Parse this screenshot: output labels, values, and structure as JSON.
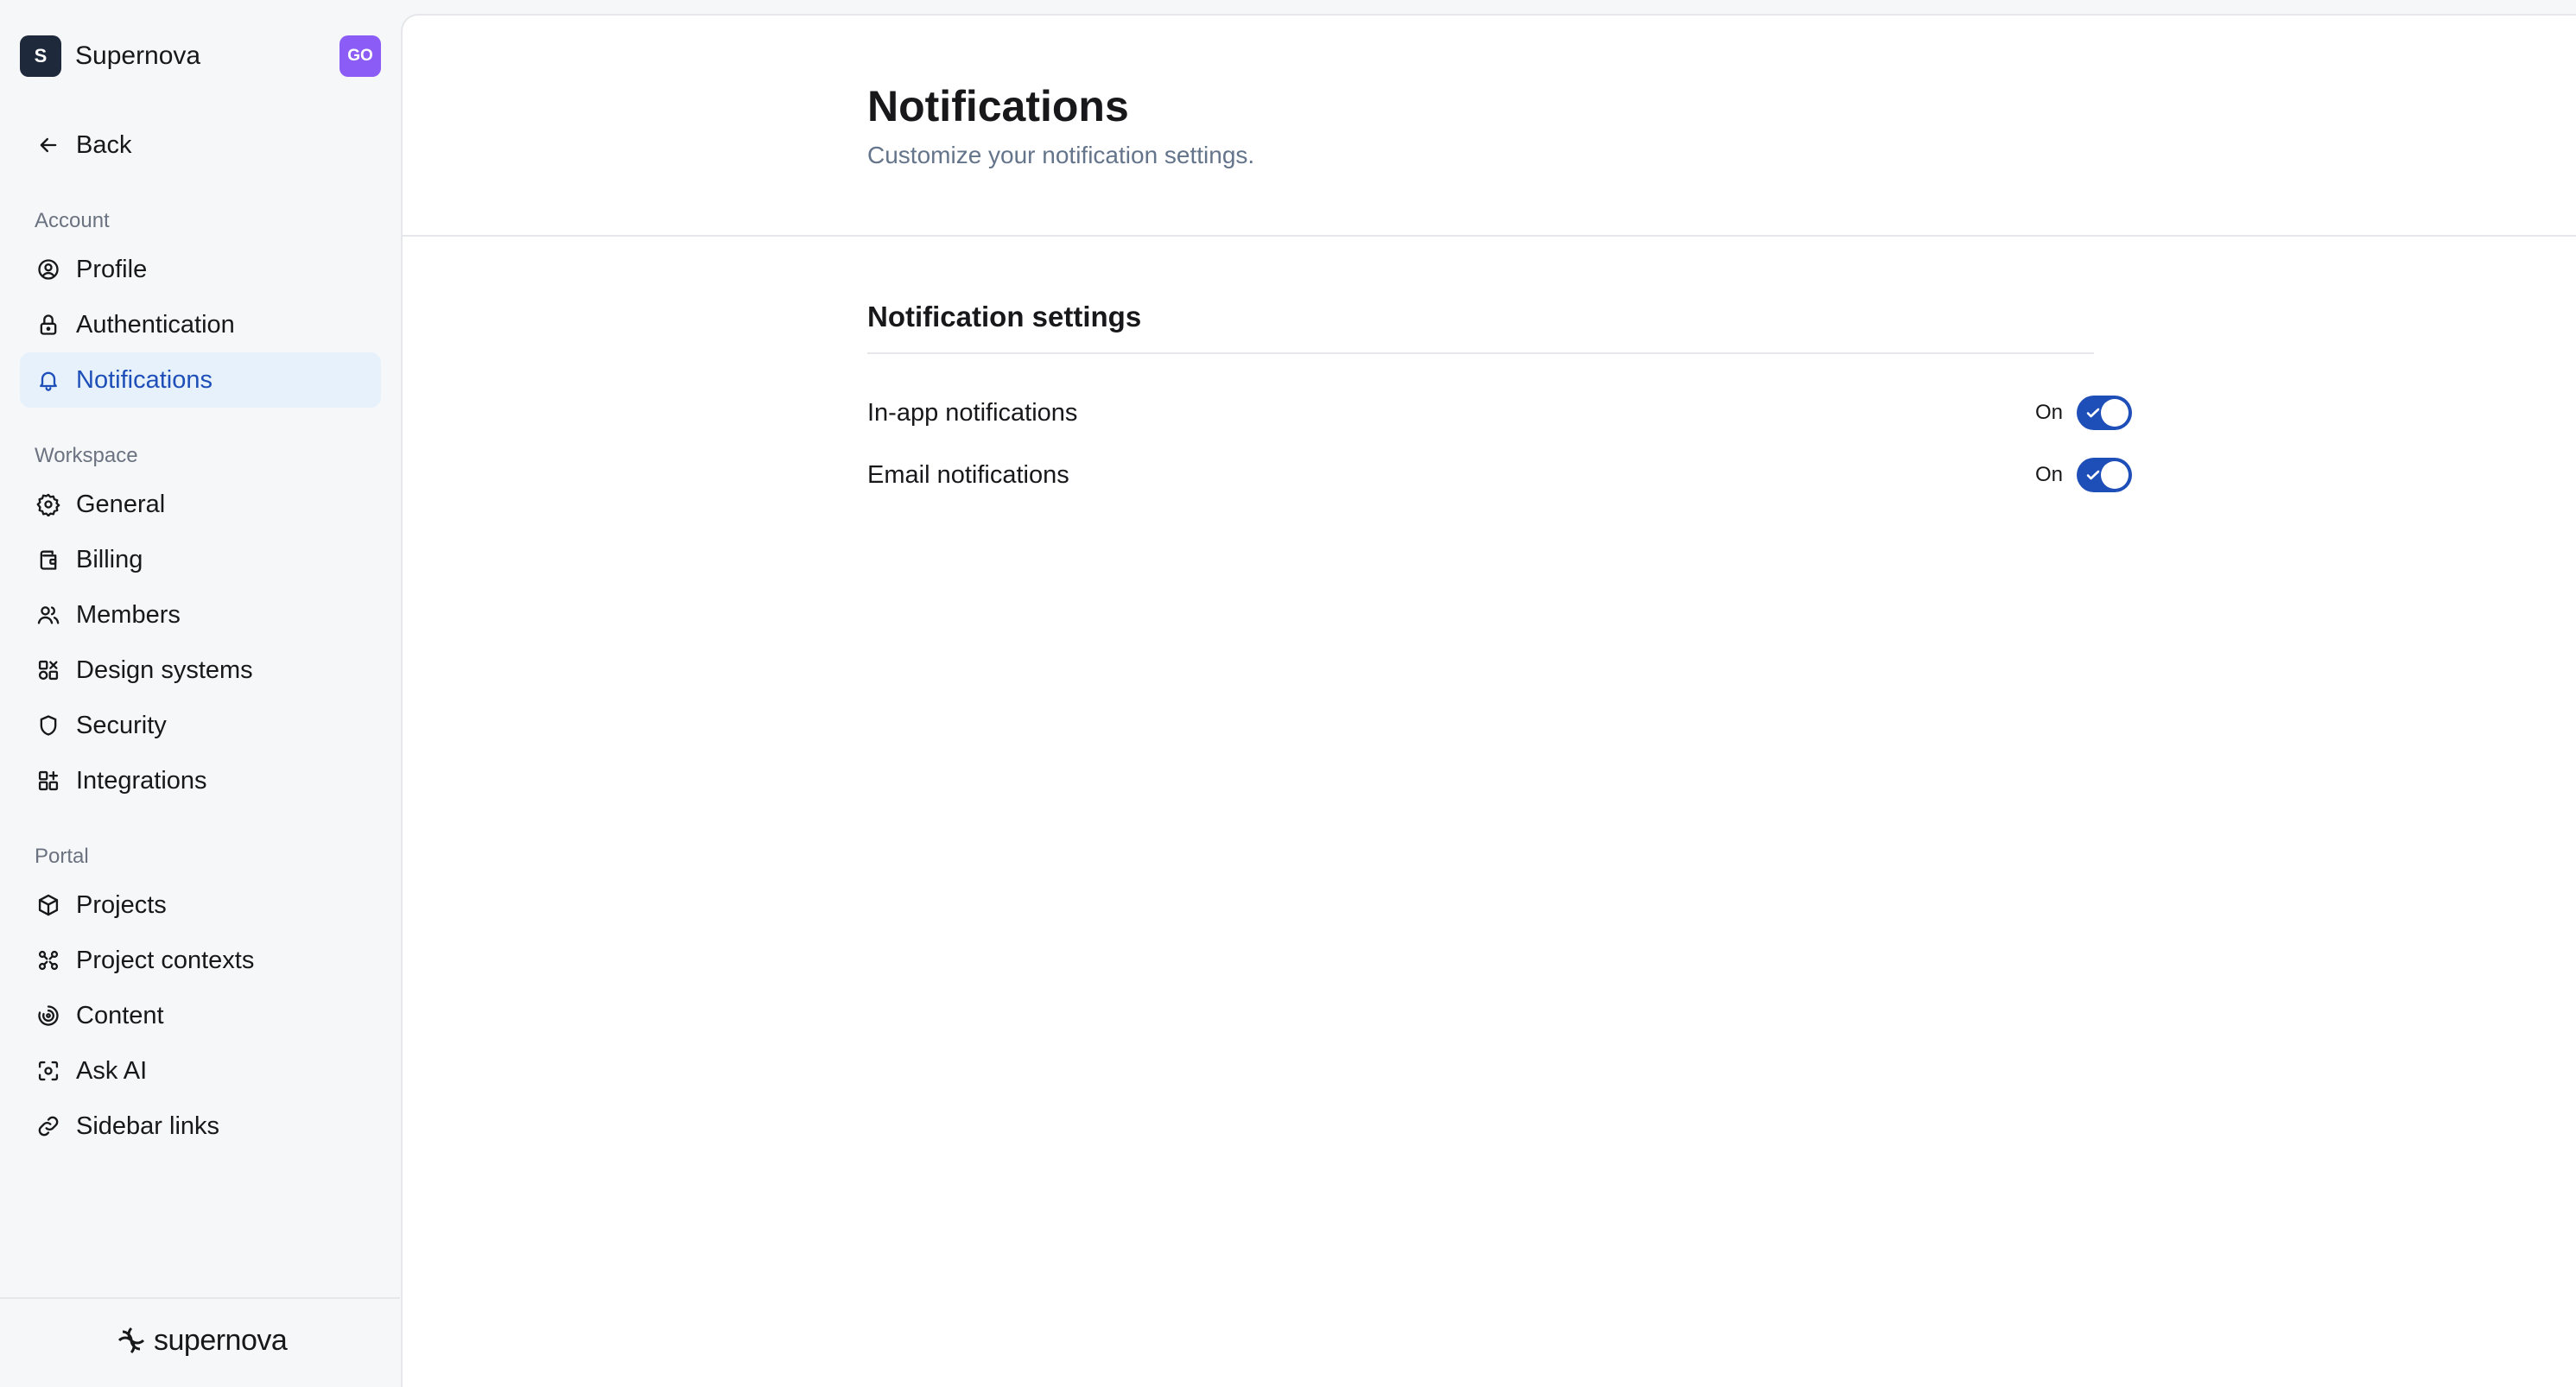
{
  "workspace": {
    "initial": "S",
    "name": "Supernova",
    "user_initials": "GO"
  },
  "back_label": "Back",
  "sidebar": {
    "sections": [
      {
        "title": "Account",
        "items": [
          {
            "label": "Profile",
            "icon": "user-circle-icon"
          },
          {
            "label": "Authentication",
            "icon": "lock-icon"
          },
          {
            "label": "Notifications",
            "icon": "bell-icon",
            "active": true
          }
        ]
      },
      {
        "title": "Workspace",
        "items": [
          {
            "label": "General",
            "icon": "gear-icon"
          },
          {
            "label": "Billing",
            "icon": "wallet-icon"
          },
          {
            "label": "Members",
            "icon": "users-icon"
          },
          {
            "label": "Design systems",
            "icon": "shapes-icon"
          },
          {
            "label": "Security",
            "icon": "shield-icon"
          },
          {
            "label": "Integrations",
            "icon": "blocks-icon"
          }
        ]
      },
      {
        "title": "Portal",
        "items": [
          {
            "label": "Projects",
            "icon": "box-icon"
          },
          {
            "label": "Project contexts",
            "icon": "nodes-icon"
          },
          {
            "label": "Content",
            "icon": "swirl-icon"
          },
          {
            "label": "Ask AI",
            "icon": "scan-face-icon"
          },
          {
            "label": "Sidebar links",
            "icon": "link-icon"
          }
        ]
      }
    ]
  },
  "brand": {
    "name": "supernova"
  },
  "page": {
    "title": "Notifications",
    "subtitle": "Customize your notification settings."
  },
  "settings": {
    "title": "Notification settings",
    "rows": [
      {
        "label": "In-app notifications",
        "status": "On",
        "enabled": true
      },
      {
        "label": "Email notifications",
        "status": "On",
        "enabled": true
      }
    ]
  },
  "colors": {
    "accent": "#1e4fb8",
    "active_bg": "#e6f1fc",
    "user_avatar": "#8b5cf6",
    "ws_avatar": "#1e293b"
  }
}
